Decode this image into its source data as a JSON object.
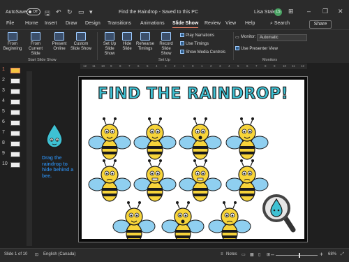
{
  "titlebar": {
    "autosave_label": "AutoSave",
    "autosave_state": "Off",
    "doc_title": "Find the Raindrop  -  Saved to this PC",
    "user_name": "Lisa Staley",
    "user_initials": "LS"
  },
  "menu": {
    "tabs": [
      "File",
      "Home",
      "Insert",
      "Draw",
      "Design",
      "Transitions",
      "Animations",
      "Slide Show",
      "Review",
      "View",
      "Help"
    ],
    "active_tab": "Slide Show",
    "search_label": "Search",
    "share_label": "Share"
  },
  "ribbon": {
    "start_group_label": "Start Slide Show",
    "setup_group_label": "Set Up",
    "monitors_group_label": "Monitors",
    "buttons": {
      "from_beginning": "From Beginning",
      "from_current": "From Current Slide",
      "present_online": "Present Online",
      "custom_show": "Custom Slide Show",
      "setup_show": "Set Up Slide Show",
      "hide_slide": "Hide Slide",
      "rehearse": "Rehearse Timings",
      "record": "Record Slide Show"
    },
    "checkboxes": {
      "play_narrations": "Play Narrations",
      "use_timings": "Use Timings",
      "show_media_controls": "Show Media Controls",
      "use_presenter_view": "Use Presenter View"
    },
    "monitor_label": "Monitor:",
    "monitor_value": "Automatic"
  },
  "ruler": {
    "ticks": [
      "12",
      "11",
      "10",
      "9",
      "8",
      "7",
      "6",
      "5",
      "4",
      "3",
      "2",
      "1",
      "0",
      "1",
      "2",
      "3",
      "4",
      "5",
      "6",
      "7",
      "8",
      "9",
      "10",
      "11",
      "12"
    ]
  },
  "thumbnails": [
    "1",
    "2",
    "3",
    "4",
    "5",
    "6",
    "7",
    "8",
    "9",
    "10"
  ],
  "slide": {
    "title": "FIND THE RAINDROP!",
    "note": "Drag the raindrop to hide behind a bee.",
    "colors": {
      "title": "#3ec1d3",
      "bee_yellow": "#f7d43a",
      "wing_blue": "#8fcff0",
      "drop": "#3ec1d3"
    }
  },
  "status": {
    "slide_counter": "Slide 1 of 10",
    "language": "English (Canada)",
    "notes_label": "Notes",
    "zoom": "68%"
  }
}
